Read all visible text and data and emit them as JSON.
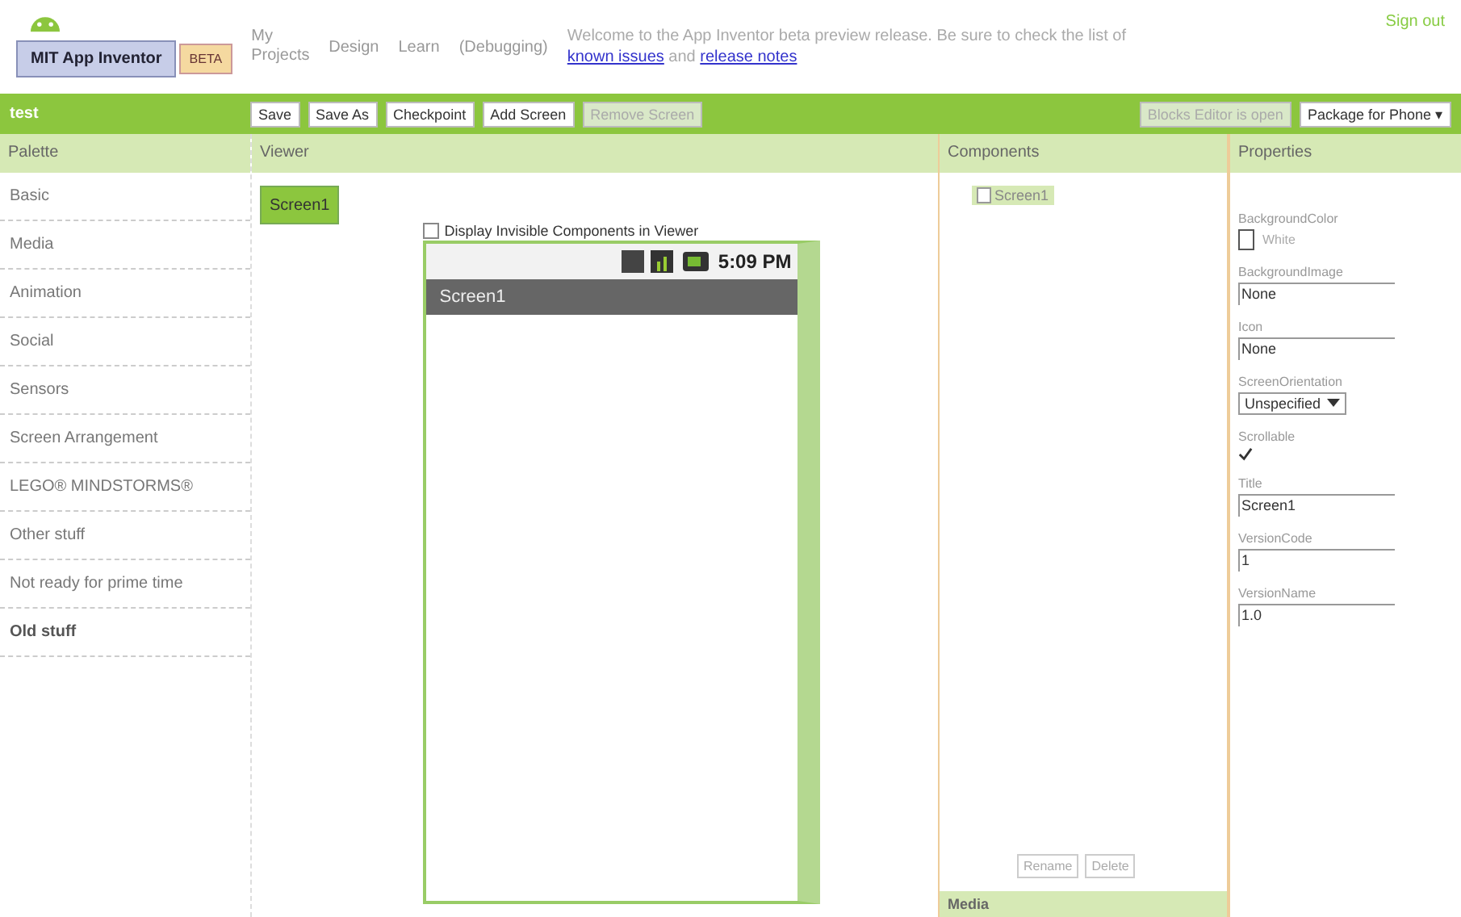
{
  "header": {
    "logo": "MIT App Inventor",
    "badge": "BETA",
    "nav": [
      "My Projects",
      "Design",
      "Learn",
      "(Debugging)"
    ],
    "welcome": "Welcome to the App Inventor beta preview release. Be sure to check the list of",
    "links": [
      "known issues",
      "release notes"
    ],
    "and": "and",
    "signout": "Sign out"
  },
  "toolbar": {
    "project": "test",
    "buttons": [
      {
        "label": "Save",
        "disabled": false
      },
      {
        "label": "Save As",
        "disabled": false
      },
      {
        "label": "Checkpoint",
        "disabled": false
      },
      {
        "label": "Add Screen",
        "disabled": false
      },
      {
        "label": "Remove Screen",
        "disabled": true
      }
    ],
    "right_buttons": [
      {
        "label": "Blocks Editor is open",
        "disabled": true
      },
      {
        "label": "Package for Phone ▾",
        "disabled": false
      }
    ]
  },
  "palette": {
    "title": "Palette",
    "items": [
      {
        "label": "Basic",
        "bold": false
      },
      {
        "label": "Media",
        "bold": false
      },
      {
        "label": "Animation",
        "bold": false
      },
      {
        "label": "Social",
        "bold": false
      },
      {
        "label": "Sensors",
        "bold": false
      },
      {
        "label": "Screen Arrangement",
        "bold": false
      },
      {
        "label": "LEGO® MINDSTORMS®",
        "bold": false
      },
      {
        "label": "Other stuff",
        "bold": false
      },
      {
        "label": "Not ready for prime time",
        "bold": false
      },
      {
        "label": "Old stuff",
        "bold": true
      }
    ]
  },
  "viewer": {
    "title": "Viewer",
    "screen_button": "Screen1",
    "display_invisible": {
      "label": "Display Invisible Components in Viewer",
      "checked": false
    },
    "phone": {
      "time": "5:09 PM",
      "title": "Screen1"
    }
  },
  "components": {
    "title": "Components",
    "tree": [
      {
        "label": "Screen1",
        "selected": true
      }
    ],
    "buttons": [
      "Rename",
      "Delete"
    ],
    "media_title": "Media"
  },
  "properties": {
    "title": "Properties",
    "items": [
      {
        "kind": "color",
        "label": "BackgroundColor",
        "value": "White"
      },
      {
        "kind": "text",
        "label": "BackgroundImage",
        "value": "None"
      },
      {
        "kind": "text",
        "label": "Icon",
        "value": "None"
      },
      {
        "kind": "choice",
        "label": "ScreenOrientation",
        "value": "Unspecified"
      },
      {
        "kind": "checkbox",
        "label": "Scrollable",
        "checked": true
      },
      {
        "kind": "text",
        "label": "Title",
        "value": "Screen1"
      },
      {
        "kind": "text",
        "label": "VersionCode",
        "value": "1"
      },
      {
        "kind": "text",
        "label": "VersionName",
        "value": "1.0"
      }
    ]
  }
}
